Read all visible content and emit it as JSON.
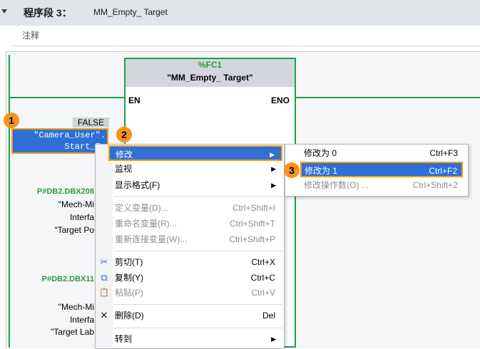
{
  "segment": {
    "title": "程序段 3：",
    "name": "MM_Empty_ Target",
    "comment_label": "注释"
  },
  "block": {
    "type_label": "%FC1",
    "name": "\"MM_Empty_ Target\"",
    "en": "EN",
    "eno": "ENO"
  },
  "params": {
    "false_value": "FALSE",
    "selected_var_line1": "\"Camera_User\".",
    "selected_var_line2": "Start_Em",
    "p2_addr": "P#DB2.DBX208",
    "p2_lines": [
      "\"Mech-Mi",
      "Interfa",
      "\"Target Po"
    ],
    "p3_addr": "P#DB2.DBX11",
    "p3_lines": [
      "\"Mech-Mi",
      "Interfa",
      "\"Target Lab"
    ]
  },
  "badges": [
    "1",
    "2",
    "3"
  ],
  "context_menu": {
    "items": [
      {
        "label": "修改",
        "shortcut": "",
        "submenu": true,
        "icon": ""
      },
      {
        "label": "监视",
        "shortcut": "",
        "submenu": true,
        "icon": ""
      },
      {
        "label": "显示格式(F)",
        "shortcut": "",
        "submenu": true,
        "icon": ""
      },
      {
        "label": "定义变量(D)...",
        "shortcut": "Ctrl+Shift+I",
        "submenu": false,
        "icon": ""
      },
      {
        "label": "重命名变量(R)...",
        "shortcut": "Ctrl+Shift+T",
        "submenu": false,
        "icon": ""
      },
      {
        "label": "重新连接变量(W)...",
        "shortcut": "Ctrl+Shift+P",
        "submenu": false,
        "icon": ""
      },
      {
        "label": "剪切(T)",
        "shortcut": "Ctrl+X",
        "submenu": false,
        "icon": "scissors-icon"
      },
      {
        "label": "复制(Y)",
        "shortcut": "Ctrl+C",
        "submenu": false,
        "icon": "copy-icon"
      },
      {
        "label": "粘贴(P)",
        "shortcut": "Ctrl+V",
        "submenu": false,
        "icon": "paste-icon"
      },
      {
        "label": "删除(D)",
        "shortcut": "Del",
        "submenu": false,
        "icon": "delete-icon"
      },
      {
        "label": "转到",
        "shortcut": "",
        "submenu": true,
        "icon": ""
      }
    ]
  },
  "submenu": {
    "items": [
      {
        "label": "修改为 0",
        "shortcut": "Ctrl+F3"
      },
      {
        "label": "修改为 1",
        "shortcut": "Ctrl+F2"
      },
      {
        "label": "修改操作数(O) ...",
        "shortcut": "Ctrl+Shift+2"
      }
    ]
  },
  "glyphs": {
    "arrow": "▶",
    "scissors": "✂",
    "copy": "⧉",
    "paste": "📋",
    "delete": "✕"
  },
  "colors": {
    "wire": "#16a34a",
    "highlight": "#2f6fd6",
    "badge": "#f7931e",
    "focus_border": "#f59e0b"
  }
}
